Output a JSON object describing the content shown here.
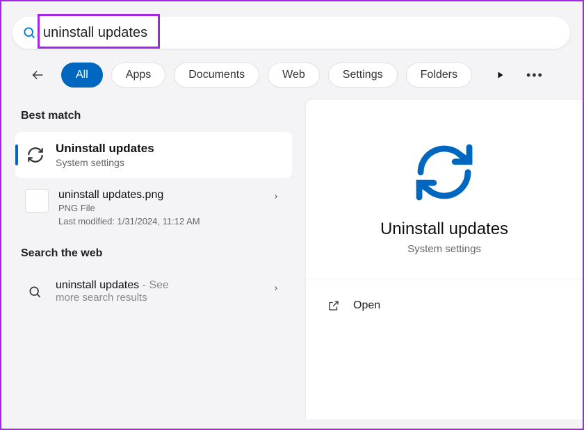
{
  "search": {
    "value": "uninstall updates"
  },
  "filters": [
    "All",
    "Apps",
    "Documents",
    "Web",
    "Settings",
    "Folders"
  ],
  "filter_active": 0,
  "sections": {
    "best_match": "Best match",
    "search_web": "Search the web"
  },
  "result_top": {
    "title": "Uninstall updates",
    "sub": "System settings"
  },
  "file_result": {
    "name": "uninstall updates",
    "ext": ".png",
    "type": "PNG File",
    "modified": "Last modified: 1/31/2024, 11:12 AM"
  },
  "web_result": {
    "term": "uninstall updates",
    "suffix": " - See",
    "sub": "more search results"
  },
  "detail": {
    "title": "Uninstall updates",
    "sub": "System settings",
    "open": "Open"
  }
}
